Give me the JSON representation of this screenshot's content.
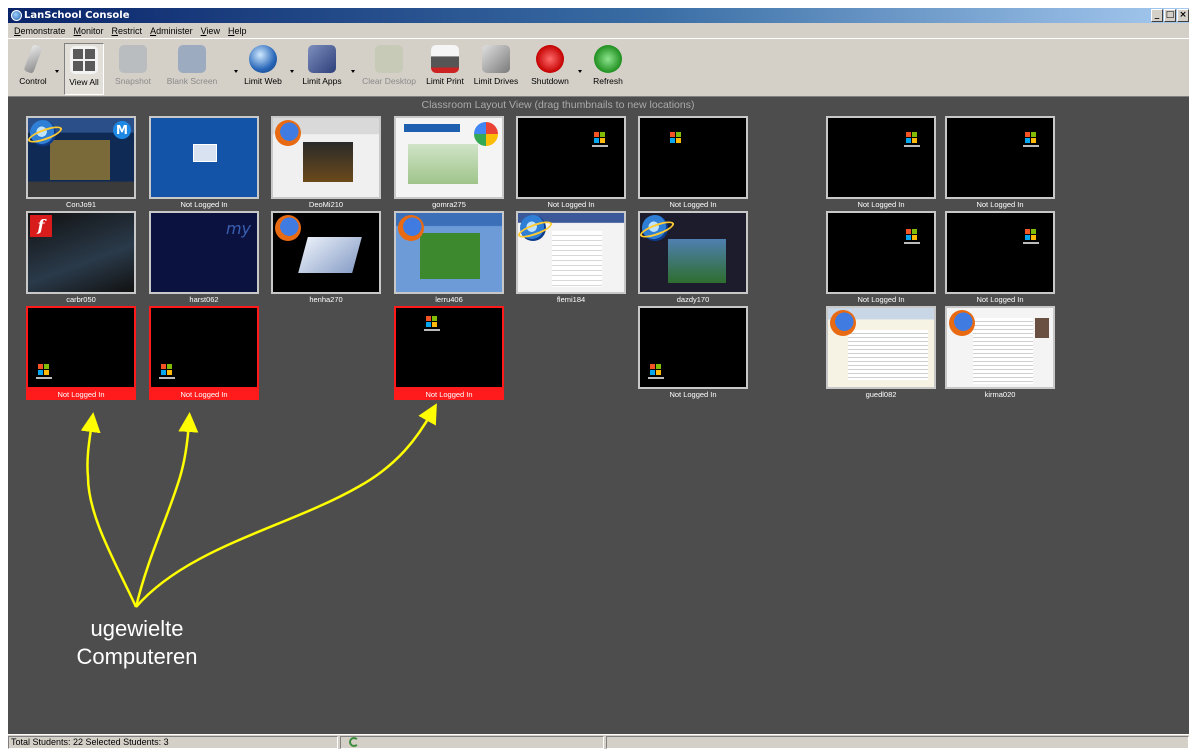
{
  "window": {
    "title": "LanSchool Console",
    "controls": [
      "_",
      "□",
      "×"
    ]
  },
  "menu": [
    "Demonstrate",
    "Monitor",
    "Restrict",
    "Administer",
    "View",
    "Help"
  ],
  "toolbar": {
    "control": "Control",
    "view_all": "View All",
    "snapshot": "Snapshot",
    "blank_screen": "Blank Screen",
    "limit_web": "Limit Web",
    "limit_apps": "Limit Apps",
    "clear_desktop": "Clear Desktop",
    "limit_print": "Limit Print",
    "limit_drives": "Limit Drives",
    "shutdown": "Shutdown",
    "refresh": "Refresh"
  },
  "main": {
    "header": "Classroom Layout View (drag thumbnails to new locations)"
  },
  "thumbnails": {
    "t1": "ConJo91",
    "t2": "Not Logged In",
    "t3": "DeoMi210",
    "t4": "gomra275",
    "t5": "Not Logged In",
    "t6": "Not Logged In",
    "t7": "Not Logged In",
    "t8": "Not Logged In",
    "t9": "carbr050",
    "t10": "harst062",
    "t11": "henha270",
    "t12": "lerru406",
    "t13": "flemi184",
    "t14": "dazdy170",
    "t15": "Not Logged In",
    "t16": "Not Logged In",
    "t17": "Not Logged In",
    "t18": "Not Logged In",
    "t19": "Not Logged In",
    "t20": "Not Logged In",
    "t21": "guedl082",
    "t22": "kirma020"
  },
  "annotation": {
    "line1": "ugewielte",
    "line2": "Computeren",
    "color": "#ffff00"
  },
  "status": {
    "text": "Total Students: 22  Selected Students: 3"
  },
  "colors": {
    "selected": "#ff1b1b",
    "canvas": "#4d4d4d",
    "chrome": "#d4d0c8"
  }
}
